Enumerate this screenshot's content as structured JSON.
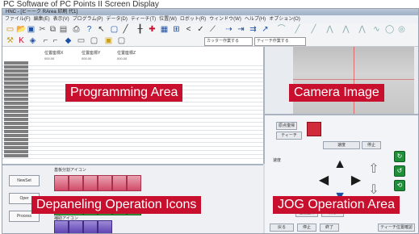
{
  "window": {
    "caption": "PC Software of PC Points II Screen Display",
    "title_bar": "HNC - [ビーーク RArea 印刷 代1]",
    "menu": [
      "ファイル(F)",
      "編集(E)",
      "表示(V)",
      "プログラム(P)",
      "データ(D)",
      "ティーチ(T)",
      "位置(W)",
      "ロボット(R)",
      "ウィンドウ(W)",
      "ヘルプ(H)",
      "オプション(O)"
    ]
  },
  "toolbar": {
    "combo_1": "カッター作業する",
    "combo_2": "ティーチ作業する"
  },
  "programming": {
    "column_headers": [
      "位置座標X",
      "位置座標Y",
      "位置座標Z"
    ],
    "first_row": [
      "000.00",
      "000.00",
      "000.00"
    ]
  },
  "jog": {
    "buttons": [
      "原点復帰",
      "ティーチ",
      "保存",
      "位置登録",
      "速度",
      "停止",
      "戻る",
      "終了",
      "ティーチ位置確認"
    ],
    "speed_label": "速度"
  },
  "icons_panel": {
    "side_buttons": [
      "NewSet",
      "Oper",
      "Process"
    ],
    "section_top": "基板分割アイコン",
    "section_bottom": "補助アイコン"
  },
  "labels": {
    "programming": "Programming Area",
    "camera": "Camera Image",
    "depaneling": "Depaneling Operation Icons",
    "jog": "JOG Operation Area"
  },
  "colors": {
    "label_bg": "#c8102e",
    "label_fg": "#ffffff"
  }
}
